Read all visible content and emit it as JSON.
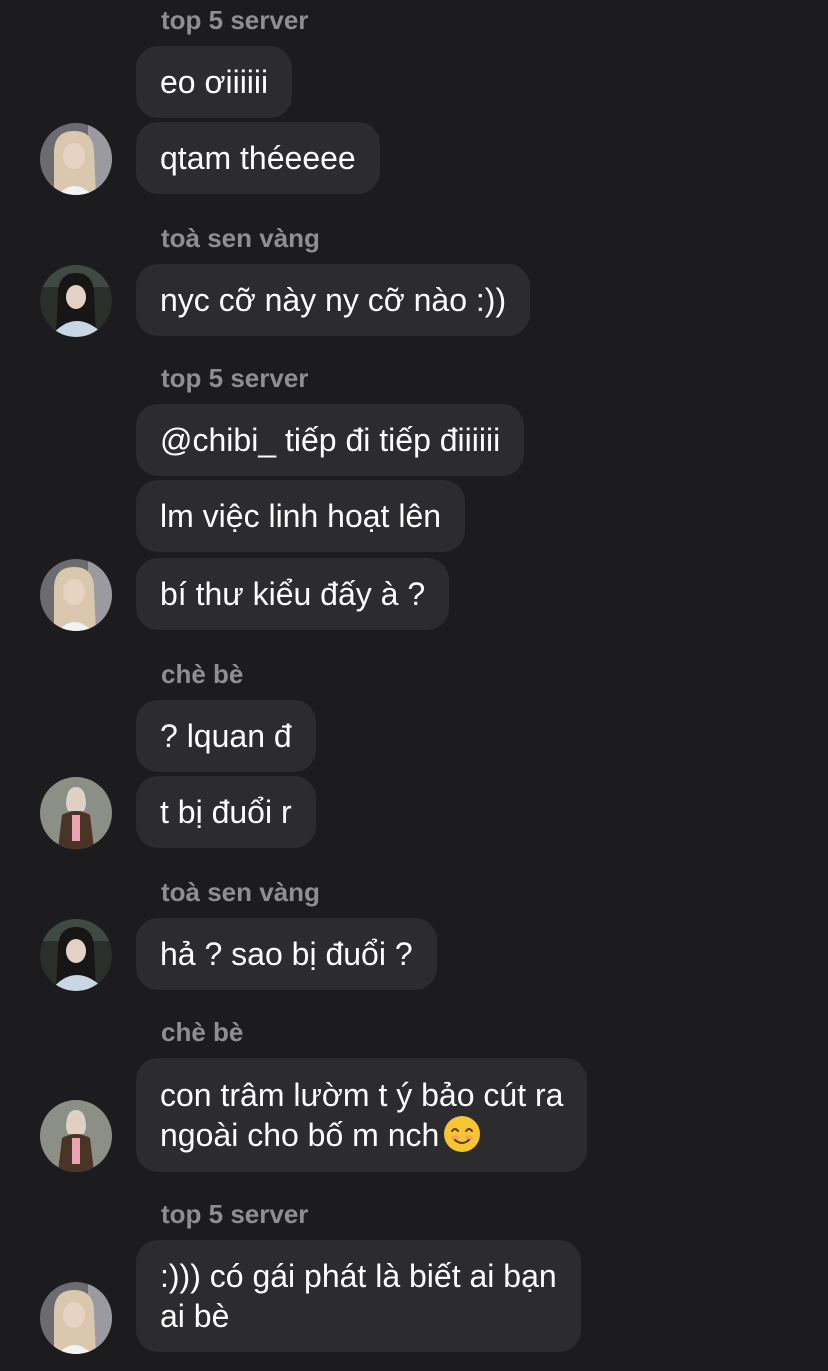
{
  "messages": {
    "m1": {
      "sender": "top 5 server",
      "bubbles": [
        "eo ơiiiiii",
        "qtam théeeee"
      ]
    },
    "m2": {
      "sender": "toà sen vàng",
      "bubbles": [
        "nyc cỡ này ny cỡ nào :))"
      ]
    },
    "m3": {
      "sender": "top 5 server",
      "bubbles": [
        "@chibi_ tiếp đi tiếp điiiiii",
        "lm việc linh hoạt lên",
        "bí thư kiểu đấy à ?"
      ]
    },
    "m4": {
      "sender": "chè bè",
      "bubbles": [
        "? lquan đ",
        "t bị đuổi r"
      ]
    },
    "m5": {
      "sender": "toà sen vàng",
      "bubbles": [
        "hả ? sao bị đuổi ?"
      ]
    },
    "m6": {
      "sender": "chè bè",
      "bubbles": [
        "con trâm lườm t ý bảo cút ra\nngoài cho bố m nch"
      ],
      "emoji": "smiling-face-emoji"
    },
    "m7": {
      "sender": "top 5 server",
      "bubbles": [
        ":))) có gái phát là biết ai bạn\nai bè"
      ]
    }
  },
  "avatars": {
    "top5server": "blonde-girl-avatar",
    "toasenvang": "dark-hair-girl-avatar",
    "chebe": "girl-brown-jacket-avatar"
  },
  "colors": {
    "background": "#1c1c1e",
    "bubble": "#2c2c2e",
    "sender_name": "#8e8e93",
    "text": "#ffffff"
  }
}
